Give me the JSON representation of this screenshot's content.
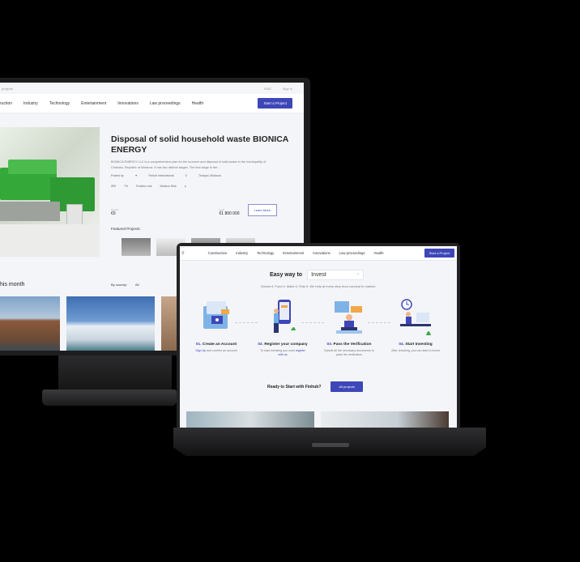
{
  "desktop": {
    "topbar": {
      "left": "projects",
      "lang": "ENG",
      "signin": "Sign in"
    },
    "nav": {
      "items": [
        "ruction",
        "Industry",
        "Technology",
        "Entertainment",
        "Innovations",
        "Law proceedings",
        "Health"
      ],
      "cta": "Start a Project"
    },
    "project": {
      "title": "Disposal of solid household waste BIONICA ENERGY",
      "description": "BIONICA ENERGY LLC is a comprehensive plan for the turnover and disposal of solid waste in the municipality of Chisinau, Republic of Moldova. It has two distinct stages. The first stage is the...",
      "posted_by_label": "Posted by",
      "posted_by": "Finhub International",
      "location": "Tiraspol, Moldova",
      "irr_label": "IRR",
      "irr": "7%",
      "risk_label": "Problem risk",
      "risk": "Medium Risk",
      "raised_label": "Raised",
      "raised": "€0",
      "goal_label": "Goal",
      "goal": "€1 800 000",
      "learn_more": "Learn More"
    },
    "featured_label": "Featured Projects:",
    "month_heading": "his month",
    "country_filter": {
      "label": "By country:",
      "value": "All"
    }
  },
  "laptop": {
    "nav": {
      "items": [
        "Construction",
        "Industry",
        "Technology",
        "Entertainment",
        "Innovations",
        "Law proceedings",
        "Health"
      ],
      "cta": "Start a Project"
    },
    "easy_way_label": "Easy way to",
    "easy_way_value": "Invest",
    "tagline": "Dream it. Fund it. Make it. Ship it. We help at every step from concept to market.",
    "steps": [
      {
        "num": "01.",
        "title": "Create an Account",
        "desc_link": "Sign Up",
        "desc": "and confirm an account"
      },
      {
        "num": "02.",
        "title": "Register your company",
        "desc": "To start investing you must",
        "desc_link": "register with us"
      },
      {
        "num": "03.",
        "title": "Pass the Verification",
        "desc": "Submit all the necessary documents to pass the verification"
      },
      {
        "num": "04.",
        "title": "Start Investing",
        "desc": "After checking, you can start to invest"
      }
    ],
    "ready_text": "Ready to Start with Finhub?",
    "all_projects": "All projects"
  },
  "colors": {
    "accent": "#3d47b8",
    "generator_green": "#35a83a",
    "background": "#000000"
  }
}
